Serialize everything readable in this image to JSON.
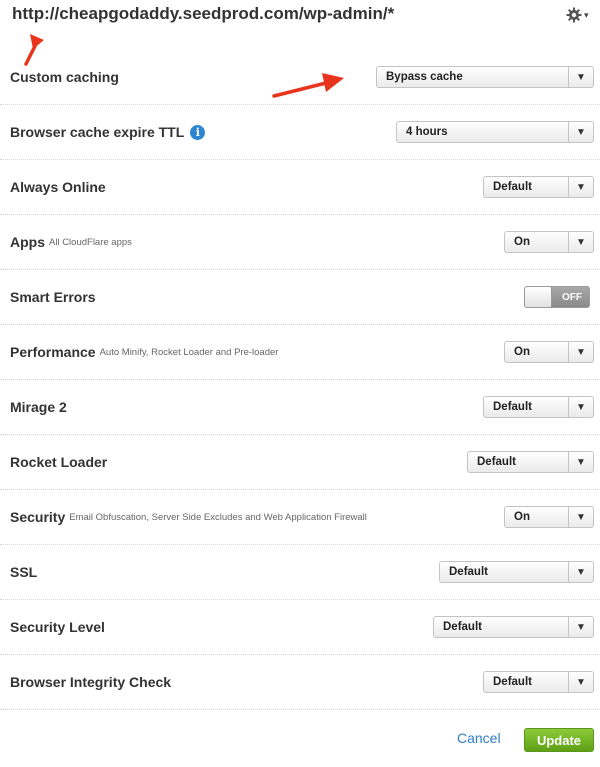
{
  "header": {
    "url": "http://cheapgodaddy.seedprod.com/wp-admin/*",
    "settings_icon": "gear-icon",
    "settings_caret": "▾"
  },
  "rows": [
    {
      "label": "Custom caching",
      "sub": "",
      "control": "select",
      "value": "Bypass cache",
      "arrow": "▼"
    },
    {
      "label": "Browser cache expire TTL",
      "sub": "",
      "info": "i",
      "control": "select",
      "value": "4 hours",
      "arrow": "▼"
    },
    {
      "label": "Always Online",
      "sub": "",
      "control": "select",
      "value": "Default",
      "arrow": "▼"
    },
    {
      "label": "Apps",
      "sub": "All CloudFlare apps",
      "control": "select",
      "value": "On",
      "arrow": "▼"
    },
    {
      "label": "Smart Errors",
      "sub": "",
      "control": "toggle",
      "value": "OFF"
    },
    {
      "label": "Performance",
      "sub": "Auto Minify, Rocket Loader and Pre-loader",
      "control": "select",
      "value": "On",
      "arrow": "▼"
    },
    {
      "label": "Mirage 2",
      "sub": "",
      "control": "select",
      "value": "Default",
      "arrow": "▼"
    },
    {
      "label": "Rocket Loader",
      "sub": "",
      "control": "select",
      "value": "Default",
      "arrow": "▼"
    },
    {
      "label": "Security",
      "sub": "Email Obfuscation, Server Side Excludes and Web Application Firewall",
      "control": "select",
      "value": "On",
      "arrow": "▼"
    },
    {
      "label": "SSL",
      "sub": "",
      "control": "select",
      "value": "Default",
      "arrow": "▼"
    },
    {
      "label": "Security Level",
      "sub": "",
      "control": "select",
      "value": "Default",
      "arrow": "▼"
    },
    {
      "label": "Browser Integrity Check",
      "sub": "",
      "control": "select",
      "value": "Default",
      "arrow": "▼"
    }
  ],
  "footer": {
    "cancel_label": "Cancel",
    "update_label": "Update"
  },
  "colors": {
    "link": "#2f7fc5",
    "update_button": "#6fb22a",
    "info_icon": "#2f86d0",
    "annotation_arrow": "#e8341c"
  }
}
